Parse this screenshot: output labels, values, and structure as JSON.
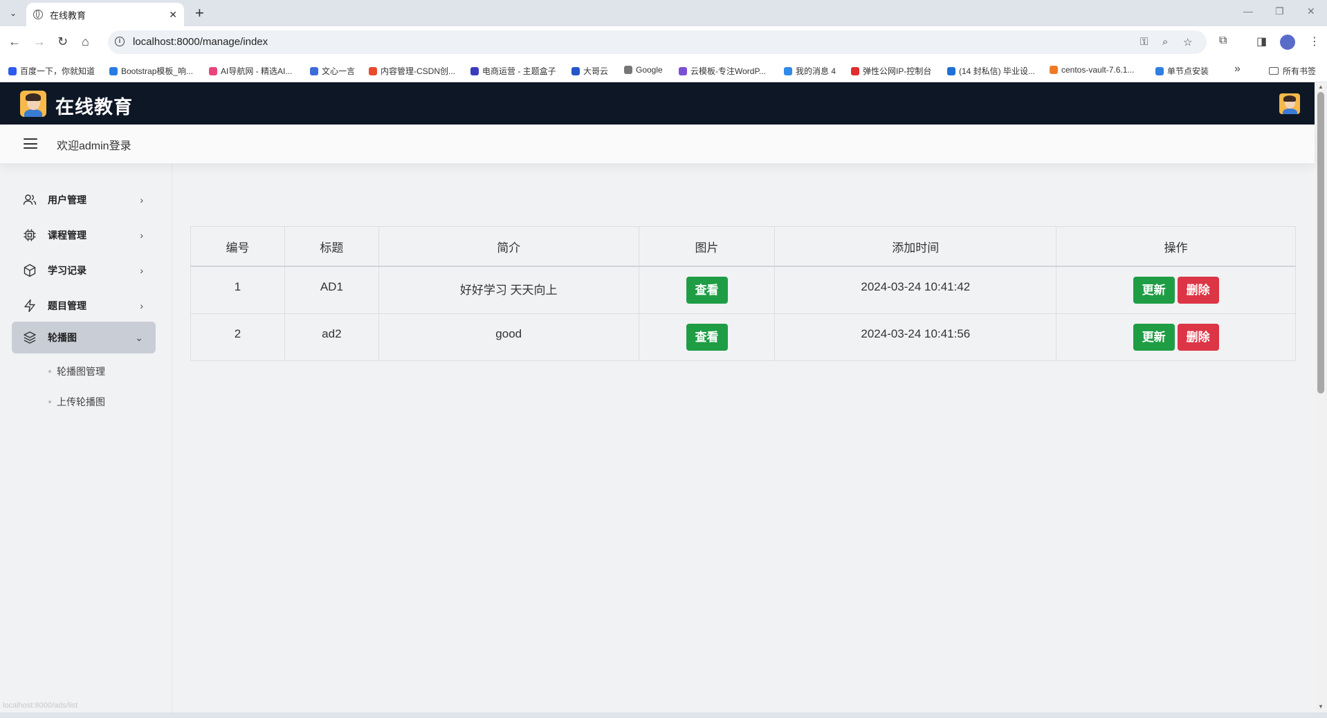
{
  "browser": {
    "tab_title": "在线教育",
    "tab_close": "✕",
    "new_tab": "+",
    "url": "localhost:8000/manage/index",
    "status_url": "localhost:8000/ads/list",
    "all_bookmarks": "所有书签",
    "bookmarks": [
      {
        "label": "百度一下，你就知道",
        "color": "#2f5bea"
      },
      {
        "label": "Bootstrap模板_响...",
        "color": "#2a7ae4"
      },
      {
        "label": "AI导航网 - 精选AI...",
        "color": "#e8457a"
      },
      {
        "label": "文心一言",
        "color": "#3f6ad8"
      },
      {
        "label": "内容管理-CSDN创...",
        "color": "#e84a2f"
      },
      {
        "label": "电商运营 - 主题盒子",
        "color": "#3b3bbd"
      },
      {
        "label": "大哥云",
        "color": "#2456c8"
      },
      {
        "label": "Google",
        "color": "#777777"
      },
      {
        "label": "云模板-专注WordP...",
        "color": "#7b4fd6"
      },
      {
        "label": "我的消息 4",
        "color": "#2f8ae8"
      },
      {
        "label": "弹性公网IP-控制台",
        "color": "#e02d2d"
      },
      {
        "label": "(14 封私信) 毕业设...",
        "color": "#1f6fd6"
      },
      {
        "label": "centos-vault-7.6.1...",
        "color": "#f07a22"
      },
      {
        "label": "单节点安装",
        "color": "#2f7fe0"
      }
    ]
  },
  "app": {
    "brand": "在线教育",
    "welcome": "欢迎admin登录"
  },
  "sidebar": {
    "items": [
      {
        "label": "用户管理",
        "icon": "users-icon",
        "expanded": false
      },
      {
        "label": "课程管理",
        "icon": "cpu-icon",
        "expanded": false
      },
      {
        "label": "学习记录",
        "icon": "box-icon",
        "expanded": false
      },
      {
        "label": "题目管理",
        "icon": "lightning-icon",
        "expanded": false
      },
      {
        "label": "轮播图",
        "icon": "layers-icon",
        "expanded": true
      }
    ],
    "subitems": [
      "轮播图管理",
      "上传轮播图"
    ]
  },
  "table": {
    "headers": [
      "编号",
      "标题",
      "简介",
      "图片",
      "添加时间",
      "操作"
    ],
    "view_label": "查看",
    "update_label": "更新",
    "delete_label": "删除",
    "rows": [
      {
        "id": "1",
        "title": "AD1",
        "intro": "好好学习 天天向上",
        "time": "2024-03-24 10:41:42"
      },
      {
        "id": "2",
        "title": "ad2",
        "intro": "good",
        "time": "2024-03-24 10:41:56"
      }
    ]
  },
  "colors": {
    "header_bg": "#0e1726",
    "btn_green": "#1f9d45",
    "btn_red": "#dc3545",
    "active_side": "#c9ced6"
  }
}
